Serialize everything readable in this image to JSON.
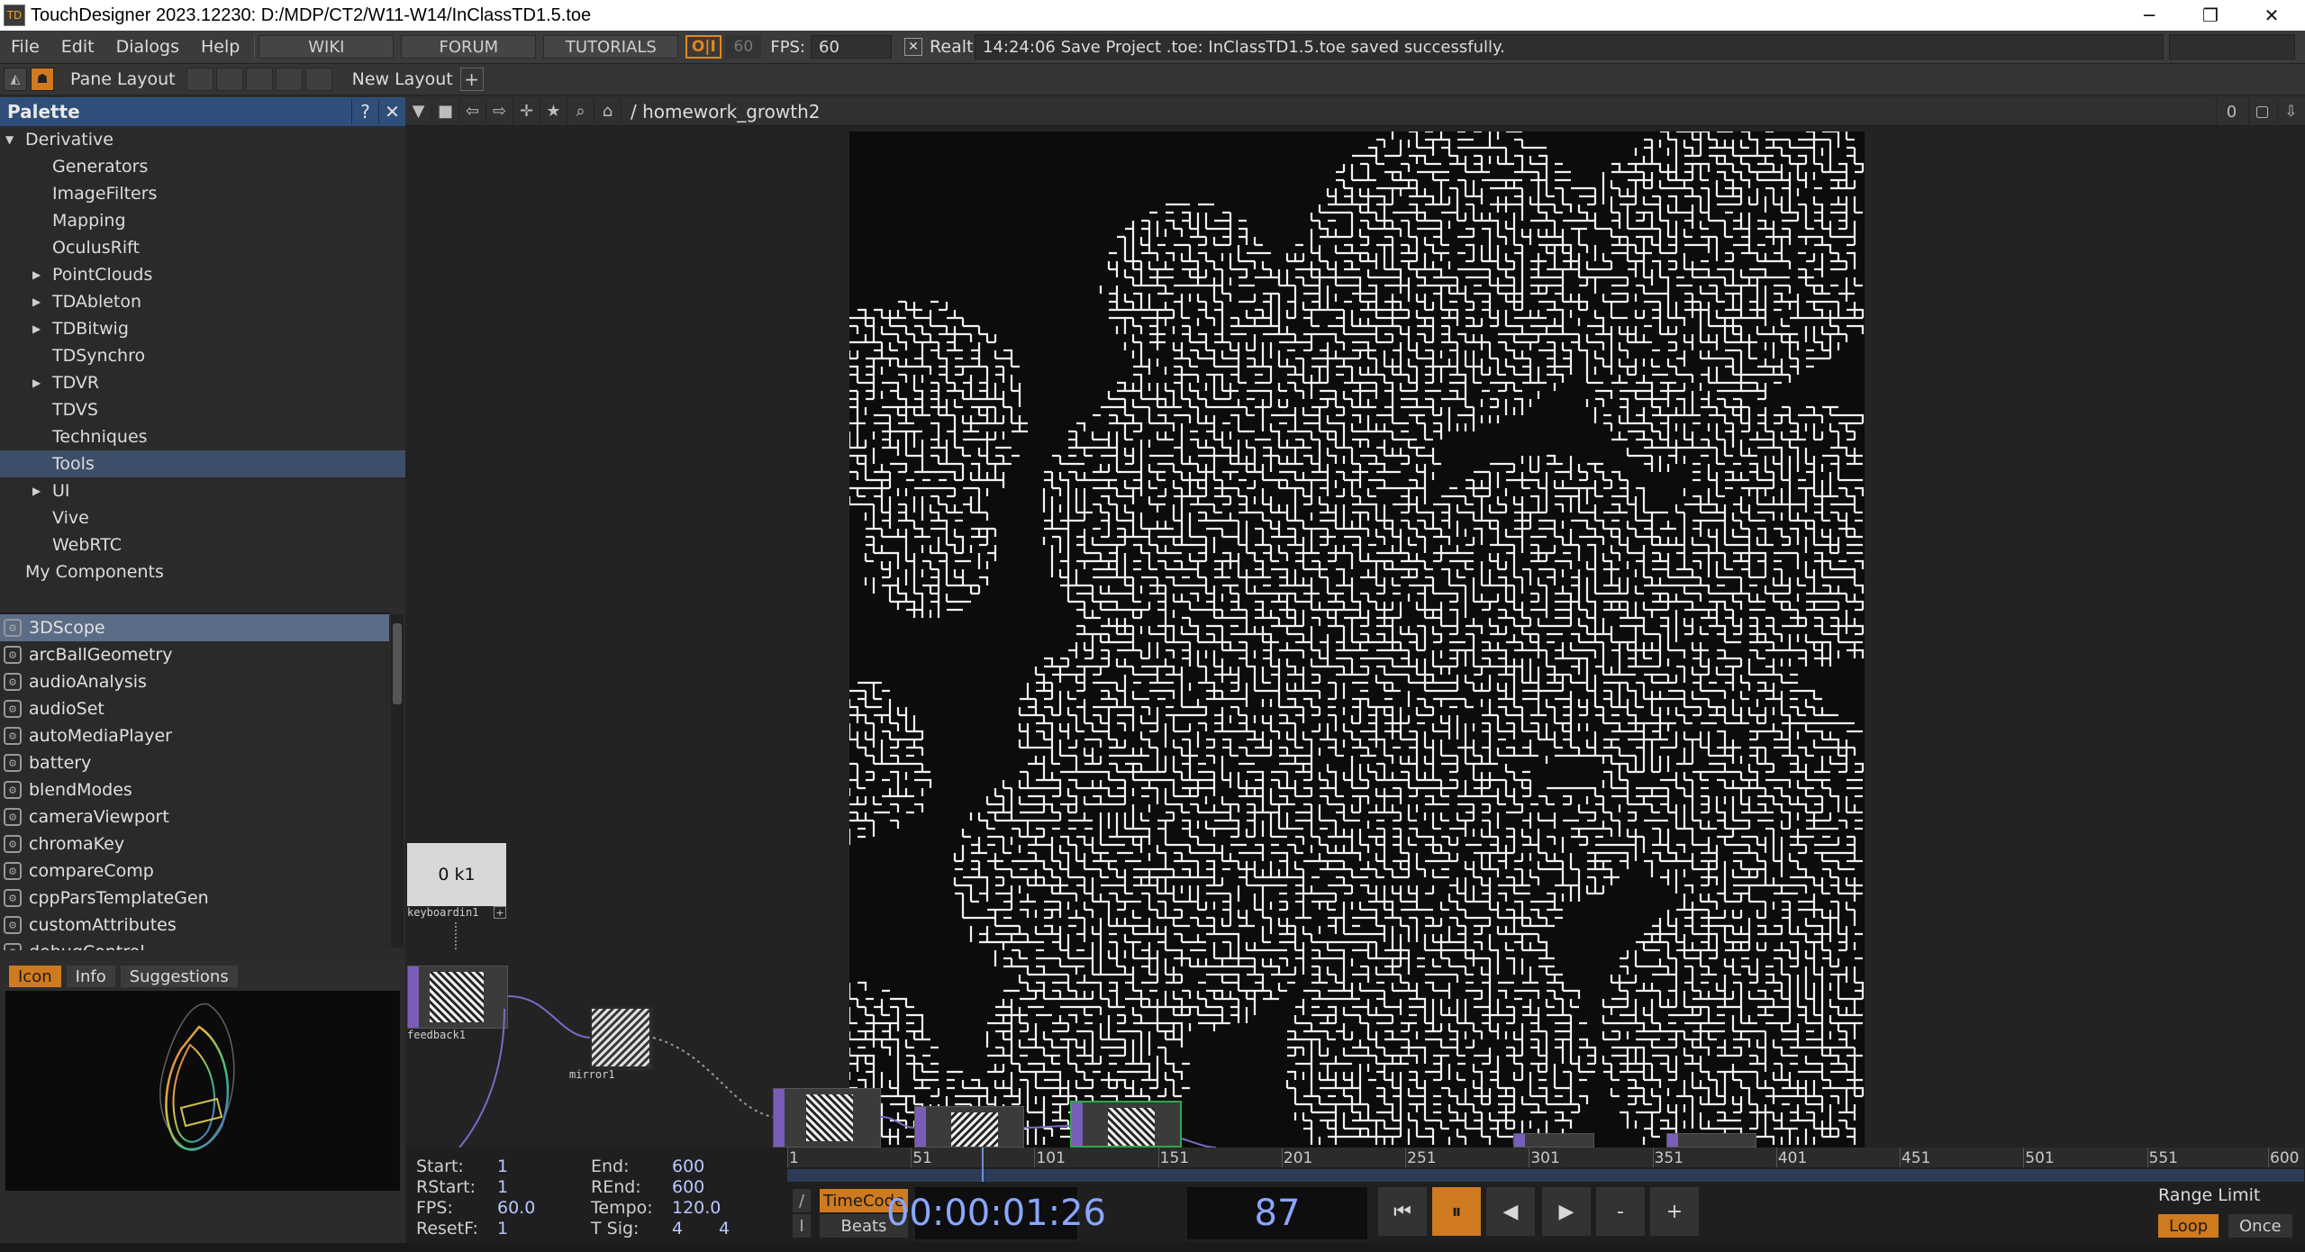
{
  "window": {
    "title": "TouchDesigner 2023.12230: D:/MDP/CT2/W11-W14/InClassTD1.5.toe",
    "minimize": "─",
    "restore": "❐",
    "close": "✕"
  },
  "menu": {
    "items": [
      "File",
      "Edit",
      "Dialogs",
      "Help"
    ],
    "links": [
      "WIKI",
      "FORUM",
      "TUTORIALS"
    ],
    "oi_label": "O|I",
    "fps_target": "60",
    "fps_label": "FPS:",
    "fps_value": "60",
    "realtime_check": "✕",
    "realtime_label": "Realtime",
    "status_message": "14:24:06 Save Project .toe: InClassTD1.5.toe saved successfully."
  },
  "panebar": {
    "pane_layout_label": "Pane Layout",
    "new_layout_label": "New Layout",
    "plus": "+"
  },
  "palette": {
    "title": "Palette",
    "help": "?",
    "close": "✕",
    "tree": [
      {
        "label": "Derivative",
        "level": 0,
        "arrow": "▼"
      },
      {
        "label": "Generators",
        "level": 1,
        "arrow": ""
      },
      {
        "label": "ImageFilters",
        "level": 1,
        "arrow": ""
      },
      {
        "label": "Mapping",
        "level": 1,
        "arrow": ""
      },
      {
        "label": "OculusRift",
        "level": 1,
        "arrow": ""
      },
      {
        "label": "PointClouds",
        "level": 1,
        "arrow": "▶"
      },
      {
        "label": "TDAbleton",
        "level": 1,
        "arrow": "▶"
      },
      {
        "label": "TDBitwig",
        "level": 1,
        "arrow": "▶"
      },
      {
        "label": "TDSynchro",
        "level": 1,
        "arrow": ""
      },
      {
        "label": "TDVR",
        "level": 1,
        "arrow": "▶"
      },
      {
        "label": "TDVS",
        "level": 1,
        "arrow": ""
      },
      {
        "label": "Techniques",
        "level": 1,
        "arrow": ""
      },
      {
        "label": "Tools",
        "level": 1,
        "arrow": "",
        "selected": true
      },
      {
        "label": "UI",
        "level": 1,
        "arrow": "▶"
      },
      {
        "label": "Vive",
        "level": 1,
        "arrow": ""
      },
      {
        "label": "WebRTC",
        "level": 1,
        "arrow": ""
      },
      {
        "label": "My Components",
        "level": 0,
        "arrow": ""
      }
    ],
    "components": [
      "3DScope",
      "arcBallGeometry",
      "audioAnalysis",
      "audioSet",
      "autoMediaPlayer",
      "battery",
      "blendModes",
      "cameraViewport",
      "chromaKey",
      "compareComp",
      "cppParsTemplateGen",
      "customAttributes",
      "debugControl"
    ],
    "preview_tabs": [
      "Icon",
      "Info",
      "Suggestions"
    ]
  },
  "network": {
    "path": "/ homework_growth2",
    "counter": "0",
    "nodes": {
      "keyboard_value": "0 k1",
      "keyboard_label": "keyboardin1",
      "feedback_label": "feedback1",
      "mirror_label": "mirror1"
    }
  },
  "timeline": {
    "start_label": "Start:",
    "start_value": "1",
    "rstart_label": "RStart:",
    "rstart_value": "1",
    "fps_label": "FPS:",
    "fps_value": "60.0",
    "resetf_label": "ResetF:",
    "resetf_value": "1",
    "end_label": "End:",
    "end_value": "600",
    "rend_label": "REnd:",
    "rend_value": "600",
    "tempo_label": "Tempo:",
    "tempo_value": "120.0",
    "tsig_label": "T Sig:",
    "tsig_value_a": "4",
    "tsig_value_b": "4",
    "ticks": [
      "1",
      "51",
      "101",
      "151",
      "201",
      "251",
      "301",
      "351",
      "401",
      "451",
      "501",
      "551",
      "600"
    ],
    "timecode_btn": "TimeCode",
    "beats_btn": "Beats",
    "timecode": "00:00:01:26",
    "frame": "87",
    "range_limit_label": "Range Limit",
    "loop_label": "Loop",
    "once_label": "Once",
    "transport": [
      "⏮",
      "⏸",
      "◀",
      "▶",
      "-",
      "+"
    ]
  }
}
